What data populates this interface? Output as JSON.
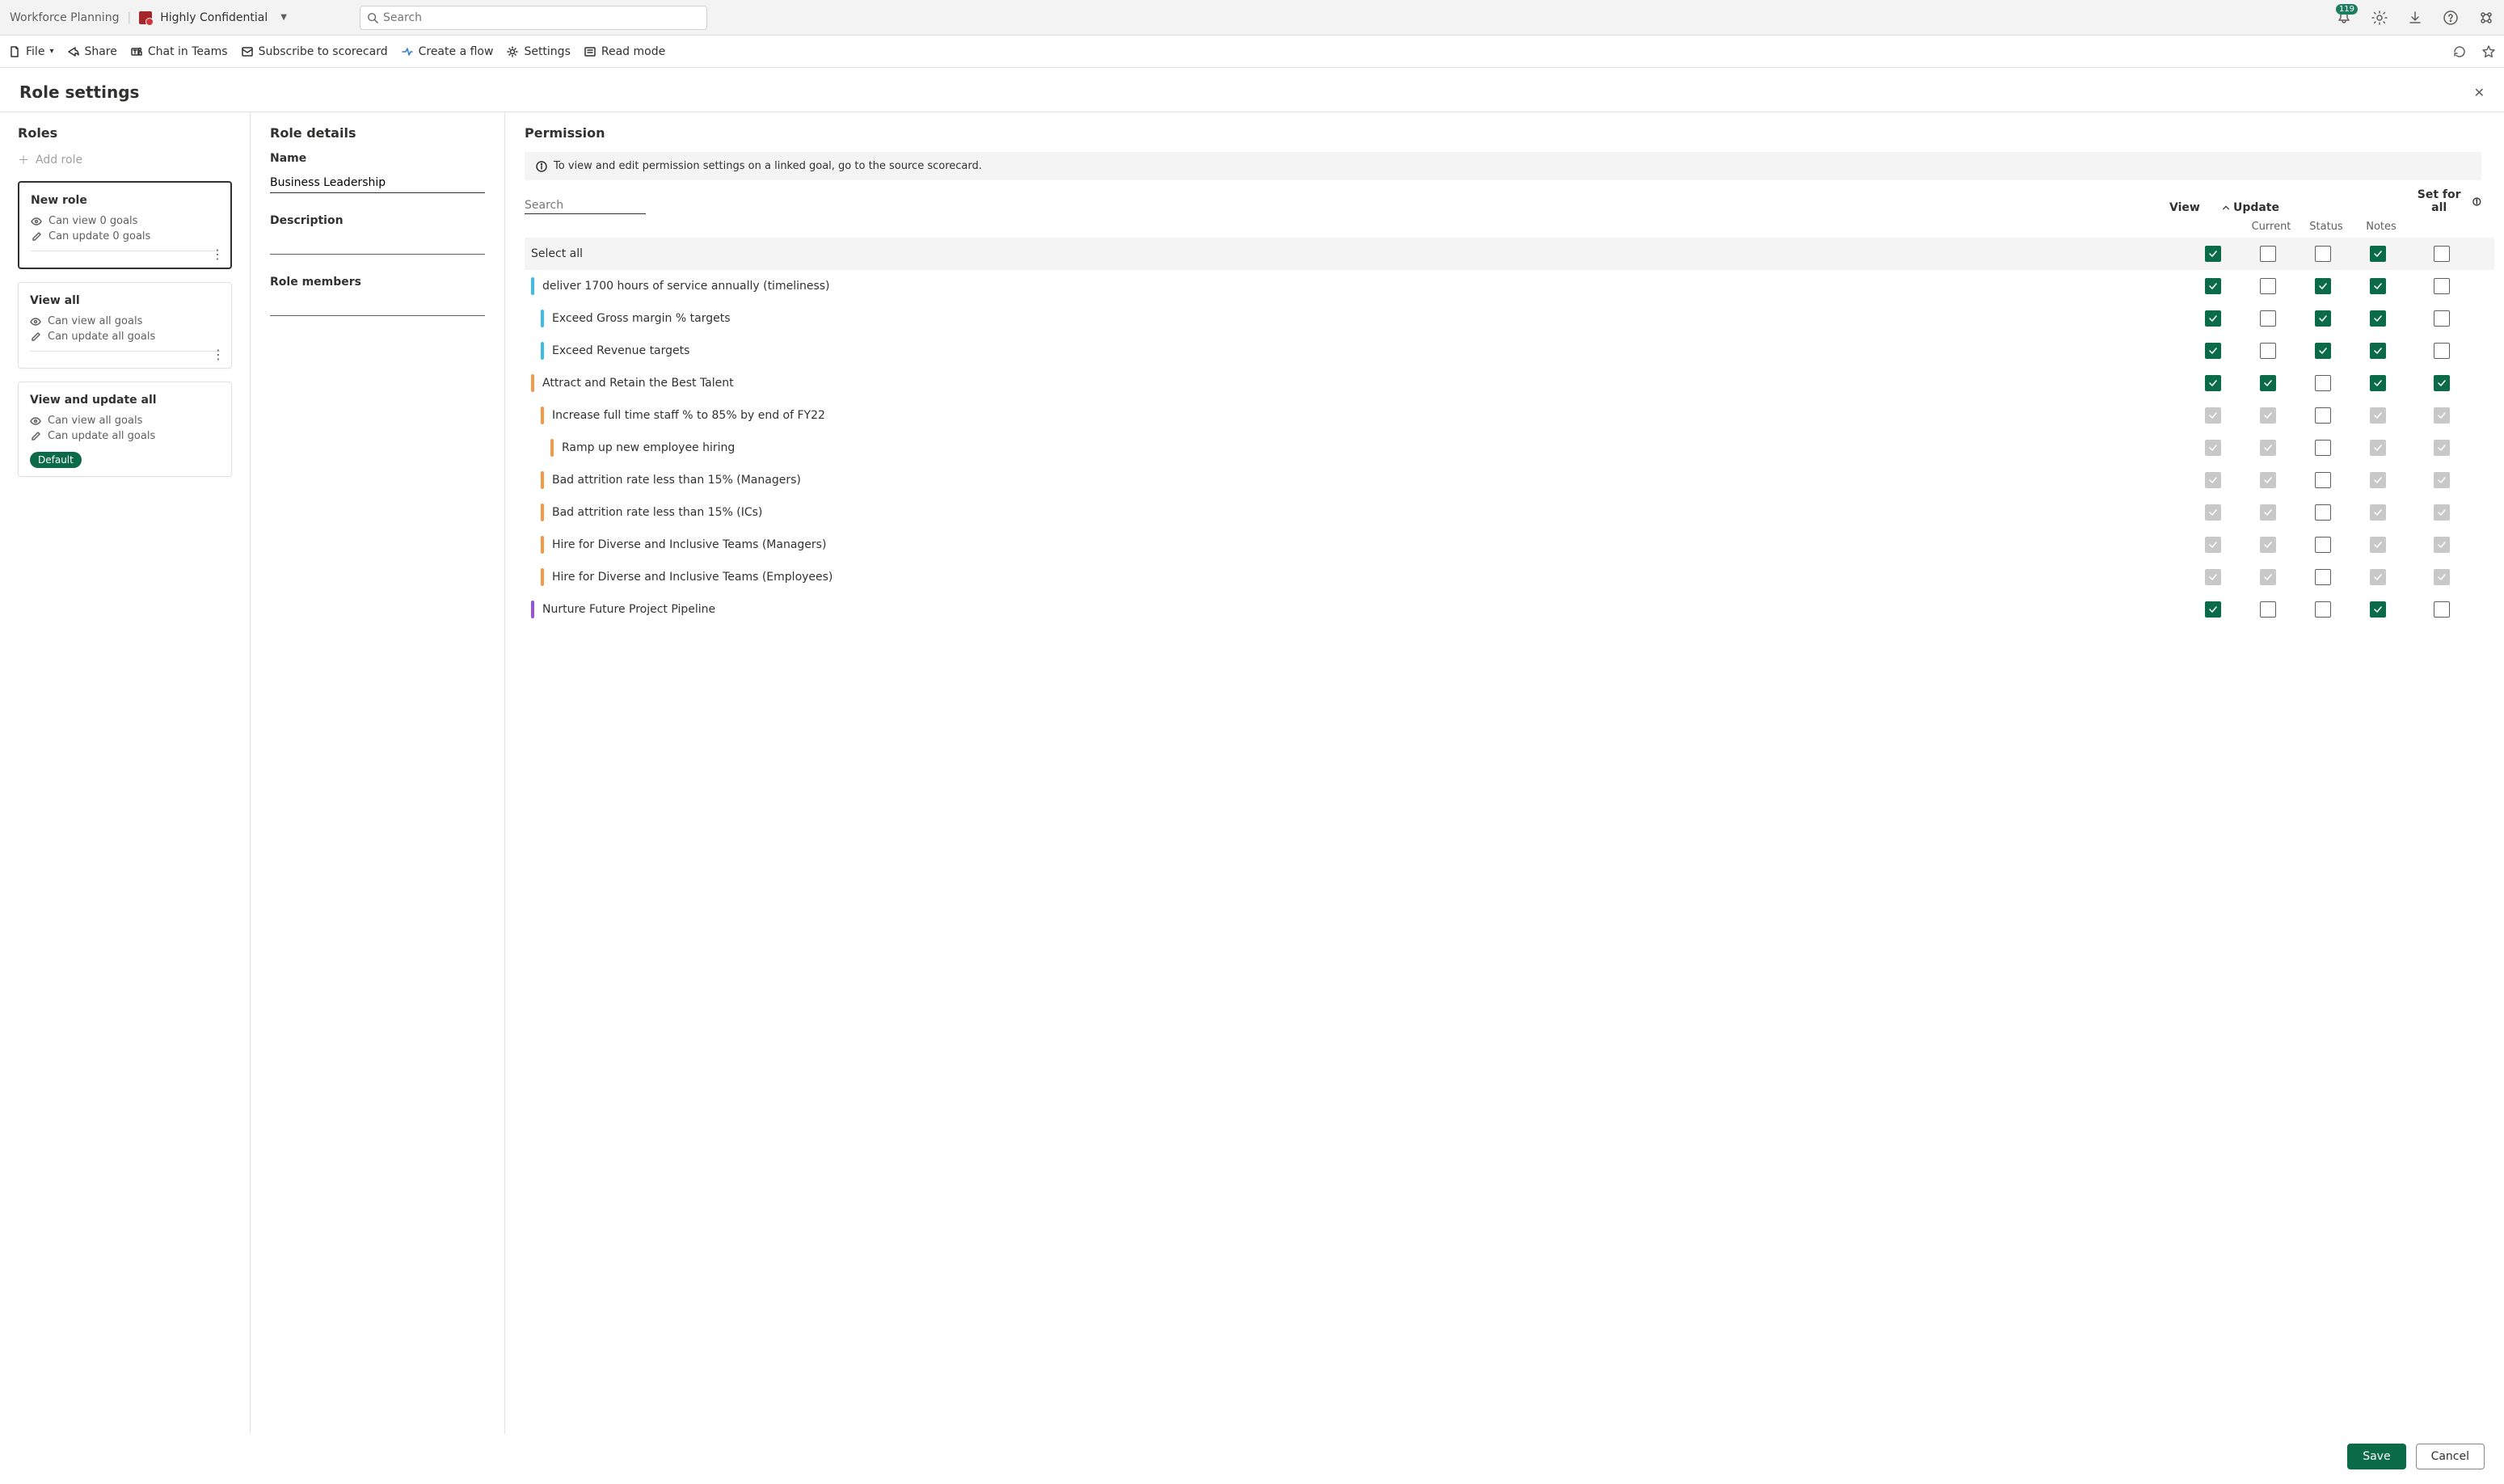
{
  "titlebar": {
    "app": "Workforce Planning",
    "classification": "Highly Confidential",
    "search_placeholder": "Search",
    "notif_count": "119"
  },
  "commands": {
    "file": "File",
    "share": "Share",
    "chat": "Chat in Teams",
    "subscribe": "Subscribe to scorecard",
    "flow": "Create a flow",
    "settings": "Settings",
    "read": "Read mode"
  },
  "panel": {
    "title": "Role settings",
    "save": "Save",
    "cancel": "Cancel"
  },
  "roles": {
    "heading": "Roles",
    "add": "Add role",
    "cards": [
      {
        "name": "New role",
        "view_line": "Can view 0 goals",
        "update_line": "Can update 0 goals",
        "selected": true,
        "has_more": true
      },
      {
        "name": "View all",
        "view_line": "Can view all goals",
        "update_line": "Can update all goals",
        "selected": false,
        "has_more": true
      },
      {
        "name": "View and update all",
        "view_line": "Can view all goals",
        "update_line": "Can update all goals",
        "selected": false,
        "default": true
      }
    ],
    "default_badge": "Default"
  },
  "details": {
    "heading": "Role details",
    "name_label": "Name",
    "name_value": "Business Leadership",
    "desc_label": "Description",
    "members_label": "Role members"
  },
  "perm": {
    "heading": "Permission",
    "info": "To view and edit permission settings on a linked goal, go to the source scorecard.",
    "search_placeholder": "Search",
    "col_view": "View",
    "col_update": "Update",
    "col_current": "Current",
    "col_status": "Status",
    "col_notes": "Notes",
    "col_setall": "Set for all",
    "select_all": "Select all",
    "goals": [
      {
        "indent": 0,
        "color": "#3dbde5",
        "text": "deliver 1700 hours of service annually (timeliness)",
        "view": "on",
        "current": "off",
        "status": "on",
        "notes": "on",
        "setall": "off"
      },
      {
        "indent": 1,
        "color": "#3dbde5",
        "text": "Exceed Gross margin % targets",
        "view": "on",
        "current": "off",
        "status": "on",
        "notes": "on",
        "setall": "off"
      },
      {
        "indent": 1,
        "color": "#3dbde5",
        "text": "Exceed Revenue targets",
        "view": "on",
        "current": "off",
        "status": "on",
        "notes": "on",
        "setall": "off"
      },
      {
        "indent": 0,
        "color": "#f2994a",
        "text": "Attract and Retain the Best Talent",
        "view": "on",
        "current": "on",
        "status": "off",
        "notes": "on",
        "setall": "on"
      },
      {
        "indent": 1,
        "color": "#f2994a",
        "text": "Increase full time staff % to 85% by end of FY22",
        "view": "dis-on",
        "current": "dis-on",
        "status": "off",
        "notes": "dis-on",
        "setall": "dis-on"
      },
      {
        "indent": 2,
        "color": "#f2994a",
        "text": "Ramp up new employee hiring",
        "view": "dis-on",
        "current": "dis-on",
        "status": "off",
        "notes": "dis-on",
        "setall": "dis-on"
      },
      {
        "indent": 1,
        "color": "#f2994a",
        "text": "Bad attrition rate less than 15% (Managers)",
        "view": "dis-on",
        "current": "dis-on",
        "status": "off",
        "notes": "dis-on",
        "setall": "dis-on"
      },
      {
        "indent": 1,
        "color": "#f2994a",
        "text": "Bad attrition rate less than 15% (ICs)",
        "view": "dis-on",
        "current": "dis-on",
        "status": "off",
        "notes": "dis-on",
        "setall": "dis-on"
      },
      {
        "indent": 1,
        "color": "#f2994a",
        "text": "Hire for Diverse and Inclusive Teams (Managers)",
        "view": "dis-on",
        "current": "dis-on",
        "status": "off",
        "notes": "dis-on",
        "setall": "dis-on"
      },
      {
        "indent": 1,
        "color": "#f2994a",
        "text": "Hire for Diverse and Inclusive Teams (Employees)",
        "view": "dis-on",
        "current": "dis-on",
        "status": "off",
        "notes": "dis-on",
        "setall": "dis-on"
      },
      {
        "indent": 0,
        "color": "#9b51e0",
        "text": "Nurture Future Project Pipeline",
        "view": "on",
        "current": "off",
        "status": "off",
        "notes": "on",
        "setall": "off"
      }
    ],
    "selall_row": {
      "view": "on",
      "current": "off",
      "status": "off",
      "notes": "on",
      "setall": "off"
    }
  }
}
